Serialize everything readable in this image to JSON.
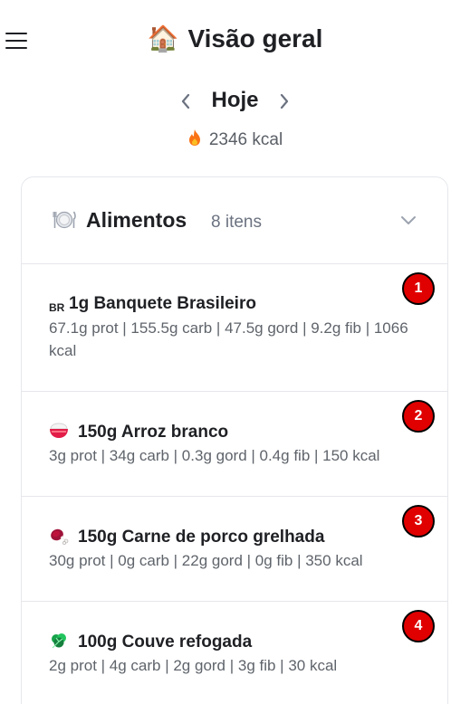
{
  "header": {
    "title_emoji": "🏠",
    "title": "Visão geral",
    "menu_icon": "hamburger-menu-icon"
  },
  "date_nav": {
    "label": "Hoje",
    "prev_icon": "chevron-left-icon",
    "next_icon": "chevron-right-icon"
  },
  "summary": {
    "kcal_text": "2346 kcal",
    "icon": "flame-icon"
  },
  "foods_card": {
    "title": "Alimentos",
    "count": "8 itens",
    "icon": "plate-icon",
    "collapse_icon": "chevron-down-icon",
    "items": [
      {
        "badge": "1",
        "emoji": "BR",
        "name": "1g Banquete Brasileiro",
        "macros": "67.1g prot | 155.5g carb | 47.5g gord | 9.2g fib | 1066 kcal"
      },
      {
        "badge": "2",
        "emoji": "rice-bowl",
        "name": "150g Arroz branco",
        "macros": "3g prot | 34g carb | 0.3g gord | 0.4g fib | 150 kcal"
      },
      {
        "badge": "3",
        "emoji": "meat-on-bone",
        "name": "150g Carne de porco grelhada",
        "macros": "30g prot | 0g carb | 22g gord | 0g fib | 350 kcal"
      },
      {
        "badge": "4",
        "emoji": "leafy-green",
        "name": "100g Couve refogada",
        "macros": "2g prot | 4g carb | 2g gord | 3g fib | 30 kcal"
      }
    ]
  },
  "colors": {
    "badge_red": "#e00000",
    "text_primary": "#1f2024",
    "text_secondary": "#5f646b",
    "border": "#e5e7eb",
    "flame": "#f97316"
  }
}
